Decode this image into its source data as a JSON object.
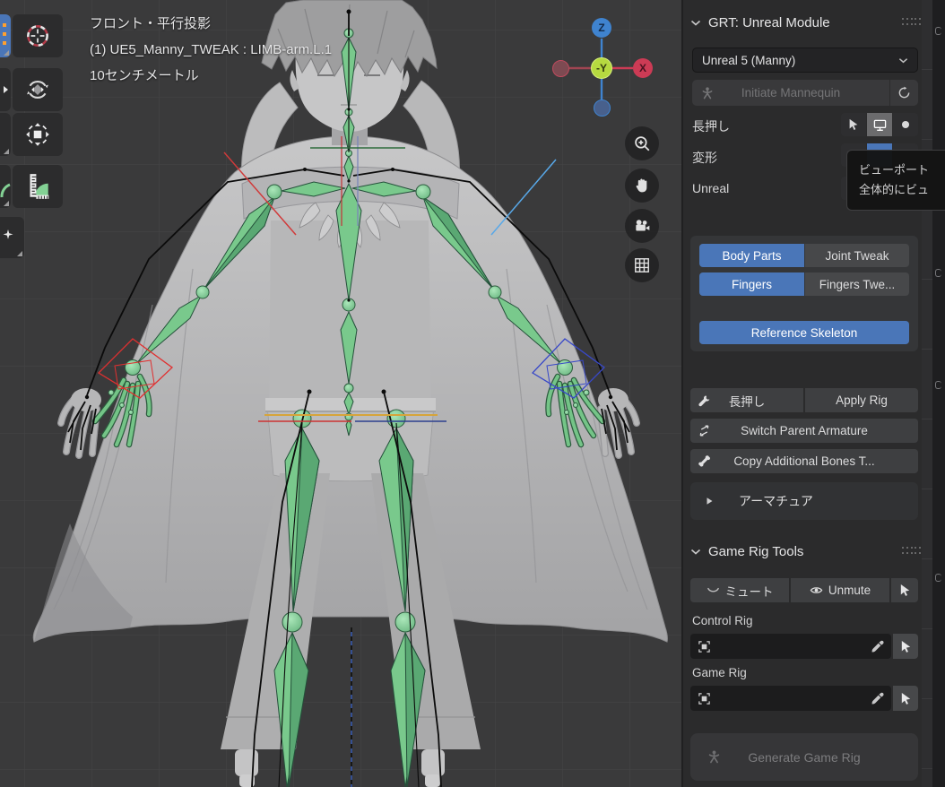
{
  "viewport": {
    "overlay_line1": "フロント・平行投影",
    "overlay_line2": "(1) UE5_Manny_TWEAK : LIMB-arm.L.1",
    "overlay_line3": "10センチメートル",
    "gizmo": {
      "z_label": "Z",
      "x_label": "X",
      "center_label": "-Y"
    }
  },
  "tooltip": {
    "line1": "ビューポート",
    "line2": "全体的にビュ"
  },
  "panel": {
    "grt": {
      "title": "GRT: Unreal Module",
      "preset_value": "Unreal 5 (Manny)",
      "initiate_label": "Initiate Mannequin",
      "row_longpress_label": "長押し",
      "row_deform_label": "変形",
      "row_unreal_label": "Unreal",
      "btn_body_parts": "Body Parts",
      "btn_joint_tweak": "Joint Tweak",
      "btn_fingers": "Fingers",
      "btn_fingers_tweak": "Fingers Twe...",
      "btn_reference_skeleton": "Reference Skeleton",
      "btn_longpress": "長押し",
      "btn_apply_rig": "Apply Rig",
      "btn_switch_parent": "Switch Parent Armature",
      "btn_copy_bones": "Copy Additional Bones T...",
      "subpanel_armature": "アーマチュア"
    },
    "game_rig_tools": {
      "title": "Game Rig Tools",
      "btn_mute": "ミュート",
      "btn_unmute": "Unmute",
      "label_control_rig": "Control Rig",
      "label_game_rig": "Game Rig",
      "btn_generate": "Generate Game Rig"
    }
  },
  "colors": {
    "accent_blue": "#4a76b8",
    "bone_green": "#79c98c",
    "axis_red": "#cc3b55",
    "axis_lime": "#b6d940",
    "axis_blue": "#3f83cf"
  }
}
